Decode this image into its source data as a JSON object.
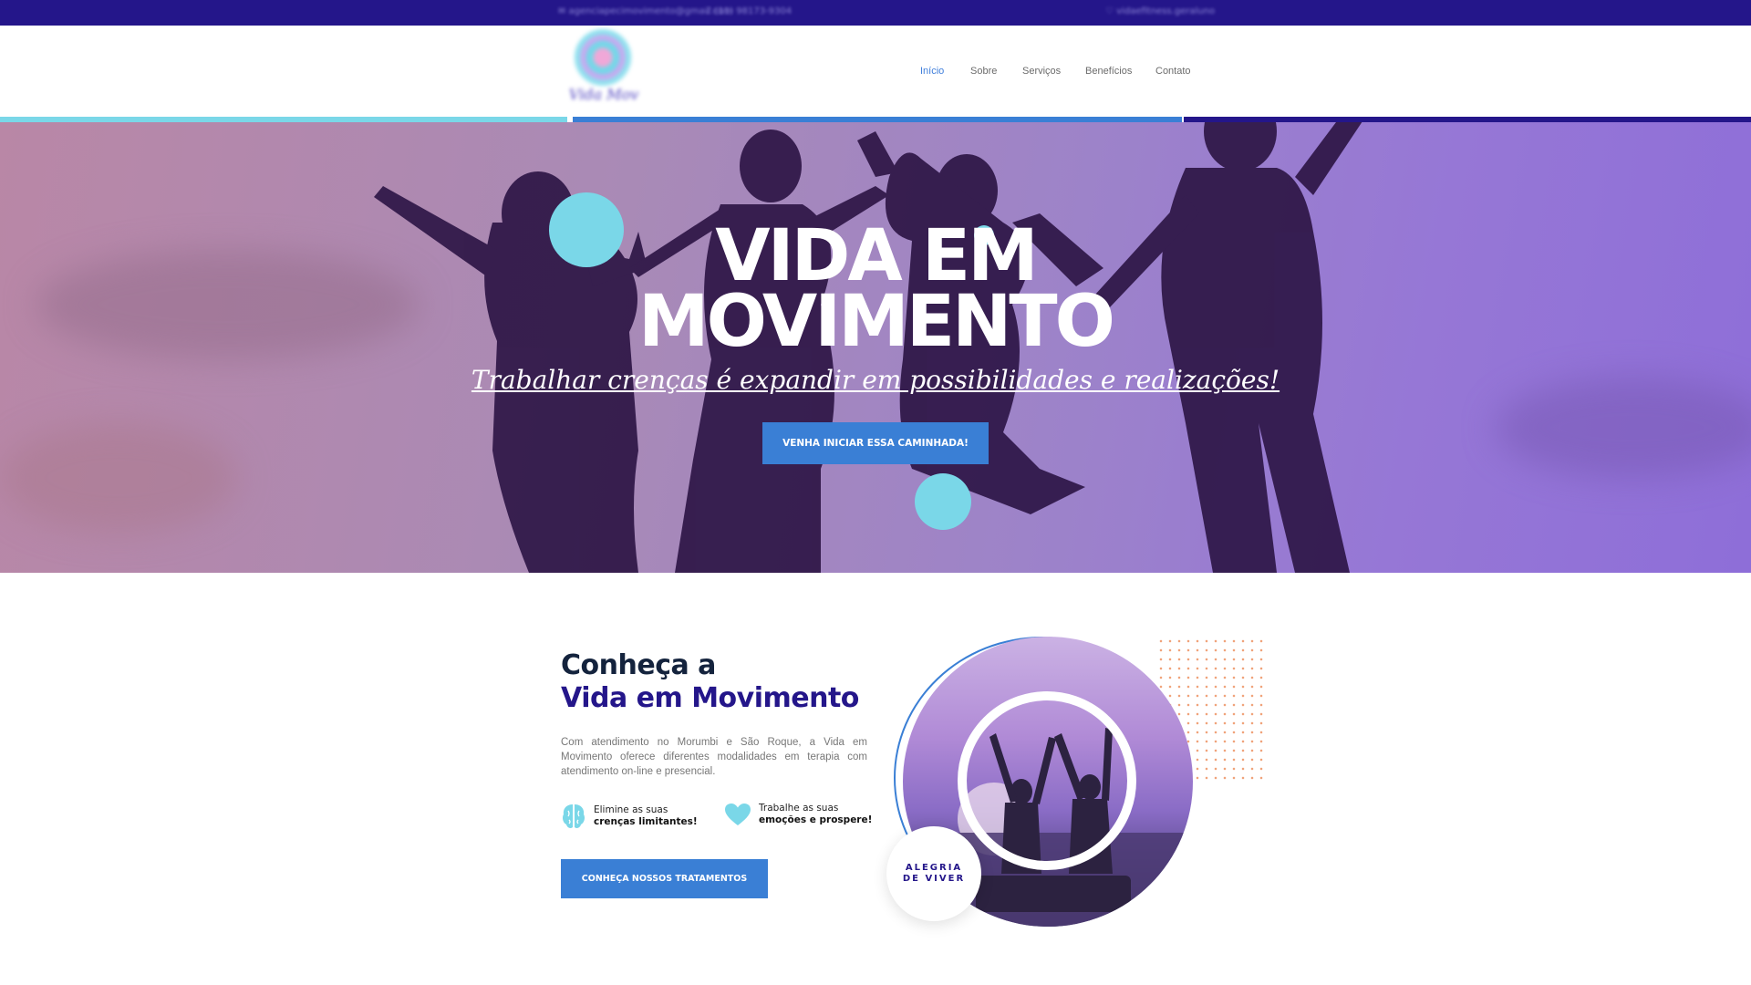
{
  "topbar": {
    "email": "✉ agenciapecimovimento@gmail.com",
    "phone": "♪ (11) 98173-9304",
    "social": "♡ vidaefitness.geraluno"
  },
  "logo": {
    "text": "Vida Mov"
  },
  "nav": {
    "items": [
      {
        "label": "Início"
      },
      {
        "label": "Sobre"
      },
      {
        "label": "Serviços"
      },
      {
        "label": "Benefícios"
      },
      {
        "label": "Contato"
      }
    ]
  },
  "hero": {
    "title_line1": "VIDA EM",
    "title_line2": "MOVIMENTO",
    "subtitle": "Trabalhar crenças é expandir em possibilidades e realizações!",
    "button": "VENHA INICIAR ESSA CAMINHADA!"
  },
  "about": {
    "heading_line1": "Conheça a",
    "heading_line2": "Vida em Movimento",
    "paragraph": "Com atendimento no Morumbi e São Roque, a Vida em Movimento oferece diferentes modalidades em terapia com atendimento on-line e presencial.",
    "features": [
      {
        "icon": "brain-icon",
        "line1": "Elimine as suas",
        "line2": "crenças limitantes!"
      },
      {
        "icon": "heart-icon",
        "line1": "Trabalhe as suas",
        "line2": "emoções e prospere!"
      }
    ],
    "button": "CONHEÇA NOSSOS TRATAMENTOS",
    "badge_line1": "ALEGRIA",
    "badge_line2": "DE VIVER"
  },
  "colors": {
    "topbar": "#24168a",
    "accent_blue": "#3a7fd5",
    "bubble": "#7ad7e8",
    "navy": "#24168a"
  }
}
